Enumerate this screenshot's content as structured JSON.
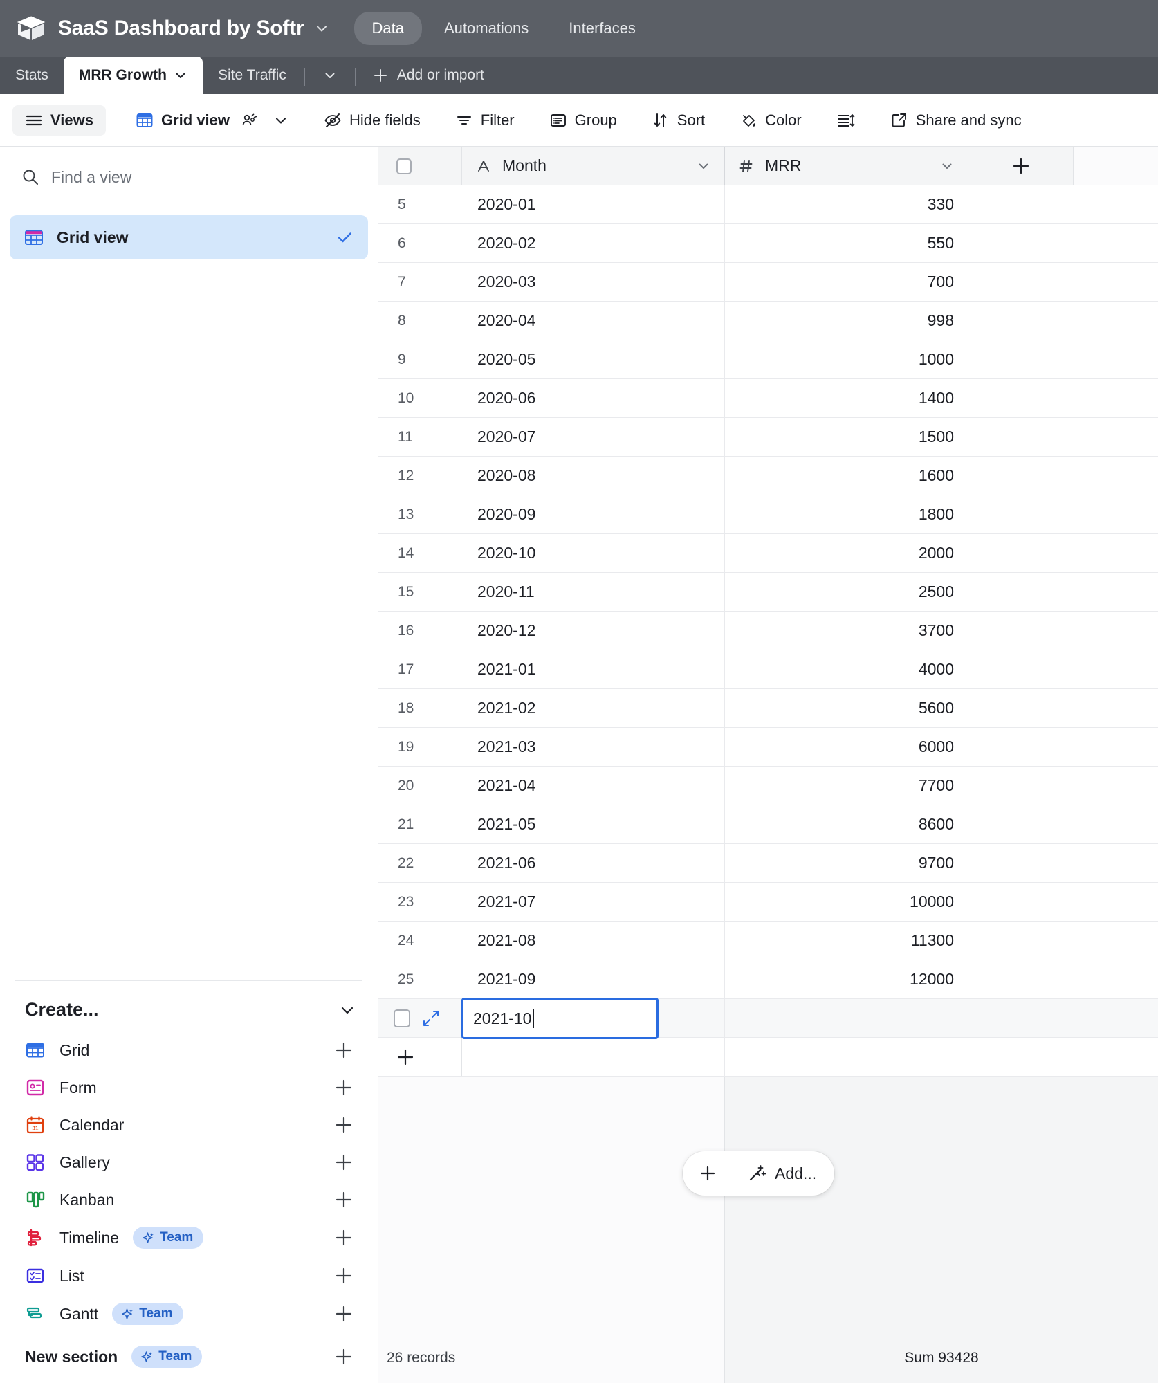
{
  "appbar": {
    "logo_icon": "cube-logo-icon",
    "title": "SaaS Dashboard by Softr",
    "title_caret_icon": "chevron-down-icon",
    "tabs": [
      {
        "label": "Data",
        "active": true
      },
      {
        "label": "Automations",
        "active": false
      },
      {
        "label": "Interfaces",
        "active": false
      }
    ]
  },
  "tabbar": {
    "tables": [
      {
        "label": "Stats",
        "active": false,
        "caret": false
      },
      {
        "label": "MRR Growth",
        "active": true,
        "caret": true
      },
      {
        "label": "Site Traffic",
        "active": false,
        "caret": false
      }
    ],
    "overflow_caret_icon": "chevron-down-icon",
    "add_label": "Add or import",
    "add_icon": "plus-icon"
  },
  "toolbar": {
    "views_label": "Views",
    "views_icon": "hamburger-icon",
    "gridview_label": "Grid view",
    "gridview_icon": "grid-icon",
    "collaborators_icon": "people-icon",
    "gridview_caret_icon": "chevron-down-icon",
    "items": [
      {
        "label": "Hide fields",
        "icon": "eye-off-icon"
      },
      {
        "label": "Filter",
        "icon": "filter-icon"
      },
      {
        "label": "Group",
        "icon": "group-icon"
      },
      {
        "label": "Sort",
        "icon": "sort-icon"
      },
      {
        "label": "Color",
        "icon": "paint-icon"
      }
    ],
    "row_height_icon": "row-height-icon",
    "share_label": "Share and sync",
    "share_icon": "external-link-icon"
  },
  "sidebar": {
    "search_placeholder": "Find a view",
    "search_value": "",
    "search_icon": "search-icon",
    "views": [
      {
        "label": "Grid view",
        "icon": "grid-icon",
        "selected": true,
        "check_icon": "check-icon"
      }
    ],
    "create_label": "Create...",
    "create_caret_icon": "chevron-down-icon",
    "create_items": [
      {
        "label": "Grid",
        "icon": "grid-icon",
        "badge": null,
        "plus_icon": "plus-icon"
      },
      {
        "label": "Form",
        "icon": "form-icon",
        "badge": null,
        "plus_icon": "plus-icon"
      },
      {
        "label": "Calendar",
        "icon": "calendar-icon",
        "badge": null,
        "plus_icon": "plus-icon"
      },
      {
        "label": "Gallery",
        "icon": "gallery-icon",
        "badge": null,
        "plus_icon": "plus-icon"
      },
      {
        "label": "Kanban",
        "icon": "kanban-icon",
        "badge": null,
        "plus_icon": "plus-icon"
      },
      {
        "label": "Timeline",
        "icon": "timeline-icon",
        "badge": "Team",
        "plus_icon": "plus-icon"
      },
      {
        "label": "List",
        "icon": "list-icon",
        "badge": null,
        "plus_icon": "plus-icon"
      },
      {
        "label": "Gantt",
        "icon": "gantt-icon",
        "badge": "Team",
        "plus_icon": "plus-icon"
      },
      {
        "label": "New section",
        "icon": null,
        "badge": "Team",
        "plus_icon": "plus-icon"
      }
    ],
    "badge_icon": "sparkle-icon"
  },
  "grid": {
    "select_all_icon": "checkbox-icon",
    "add_field_icon": "plus-icon",
    "columns": [
      {
        "name": "Month",
        "type_icon": "text-field-icon",
        "glyph": "A",
        "caret_icon": "chevron-down-icon"
      },
      {
        "name": "MRR",
        "type_icon": "number-field-icon",
        "glyph": "#",
        "caret_icon": "chevron-down-icon"
      }
    ],
    "rows": [
      {
        "num": "5",
        "month": "2020-01",
        "mrr": "330"
      },
      {
        "num": "6",
        "month": "2020-02",
        "mrr": "550"
      },
      {
        "num": "7",
        "month": "2020-03",
        "mrr": "700"
      },
      {
        "num": "8",
        "month": "2020-04",
        "mrr": "998"
      },
      {
        "num": "9",
        "month": "2020-05",
        "mrr": "1000"
      },
      {
        "num": "10",
        "month": "2020-06",
        "mrr": "1400"
      },
      {
        "num": "11",
        "month": "2020-07",
        "mrr": "1500"
      },
      {
        "num": "12",
        "month": "2020-08",
        "mrr": "1600"
      },
      {
        "num": "13",
        "month": "2020-09",
        "mrr": "1800"
      },
      {
        "num": "14",
        "month": "2020-10",
        "mrr": "2000"
      },
      {
        "num": "15",
        "month": "2020-11",
        "mrr": "2500"
      },
      {
        "num": "16",
        "month": "2020-12",
        "mrr": "3700"
      },
      {
        "num": "17",
        "month": "2021-01",
        "mrr": "4000"
      },
      {
        "num": "18",
        "month": "2021-02",
        "mrr": "5600"
      },
      {
        "num": "19",
        "month": "2021-03",
        "mrr": "6000"
      },
      {
        "num": "20",
        "month": "2021-04",
        "mrr": "7700"
      },
      {
        "num": "21",
        "month": "2021-05",
        "mrr": "8600"
      },
      {
        "num": "22",
        "month": "2021-06",
        "mrr": "9700"
      },
      {
        "num": "23",
        "month": "2021-07",
        "mrr": "10000"
      },
      {
        "num": "24",
        "month": "2021-08",
        "mrr": "11300"
      },
      {
        "num": "25",
        "month": "2021-09",
        "mrr": "12000"
      }
    ],
    "editing_row": {
      "checkbox_icon": "checkbox-icon",
      "expand_icon": "expand-record-icon",
      "value": "2021-10",
      "mrr": ""
    },
    "add_record_icon": "plus-icon",
    "add_button": {
      "plus_icon": "plus-icon",
      "ai_icon": "magic-wand-icon",
      "label": "Add..."
    },
    "footer": {
      "record_count": "26 records",
      "summary": "Sum 93428"
    }
  },
  "colors": {
    "appbar_bg": "#5b5f66",
    "tabbar_bg": "#4f535a",
    "accent_blue": "#2a6ce0",
    "selected_view_bg": "#d4e7fb",
    "badge_bg": "#cfe0fb",
    "badge_text": "#2460c4",
    "grid_header_bg": "#f4f5f6"
  }
}
